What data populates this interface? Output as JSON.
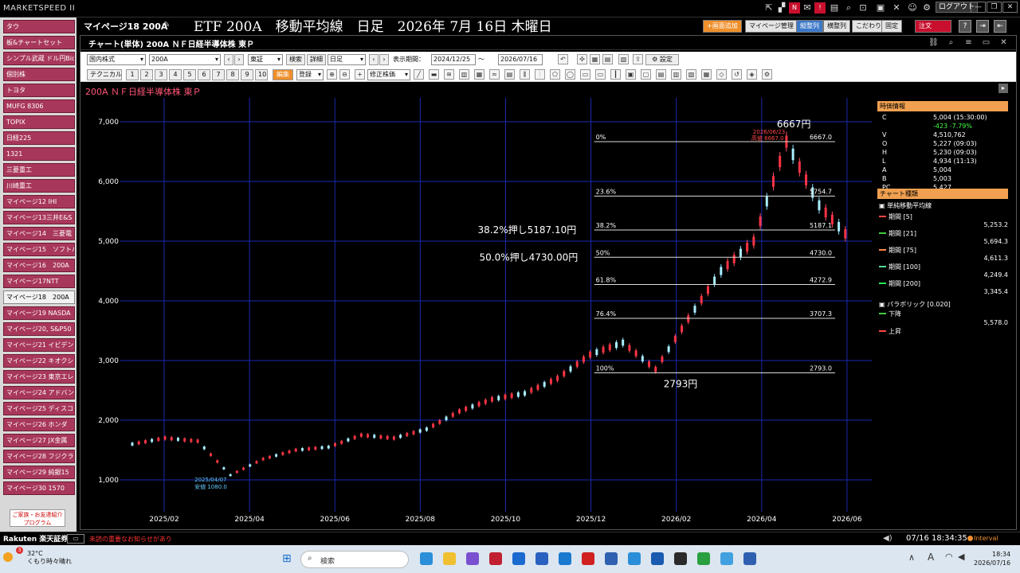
{
  "topbar": {
    "app_name": "MARKETSPEED II",
    "logout": "ログアウト"
  },
  "page": {
    "name": "マイページ18 200A",
    "title": "ETF 200A　移動平均線　日足　2026年 7月 16日 木曜日",
    "add_screen": "+画面追加",
    "mypage_manage": "マイページ管理",
    "vertical": "縦整列",
    "horizontal": "横整列",
    "custom": "こだわり",
    "fixed": "固定",
    "order": "注文",
    "help": "?"
  },
  "sidebar": {
    "items": [
      "タウ",
      "板&チャートセット",
      "シンプル武蔵 ドル円Bid",
      "個別株",
      "トヨタ",
      "MUFG 8306",
      "TOPIX",
      "日経225",
      "1321",
      "三菱重工",
      "川崎重工",
      "マイページ12 IHI",
      "マイページ13三井E&S",
      "マイページ14　三菱電",
      "マイページ15　ソフトバ",
      "マイページ16　200A",
      "マイページ17NTT",
      "マイページ18　200A",
      "マイページ19 NASDA",
      "マイページ20, S&P50",
      "マイページ21 イビデン",
      "マイページ22 キオクシ",
      "マイページ23 東京エレ",
      "マイページ24 アドバン",
      "マイページ25 ディスコ",
      "マイページ26 ホンダ",
      "マイページ27 JX金属",
      "マイページ28 フジクラ",
      "マイページ29 純銀15",
      "マイページ30 1570"
    ],
    "active_index": 17,
    "promo": "ご家族・お友達紹介プログラム"
  },
  "window": {
    "title": "チャート(単体) 200A ＮＦ日経半導体株 東Ｐ"
  },
  "toolbar1": {
    "market": "国内株式",
    "code": "200A",
    "exchange": "東証",
    "search": "検索",
    "detail": "詳細",
    "period": "日足",
    "display_period_label": "表示期間：",
    "date_from": "2024/12/25",
    "tilde": "～",
    "date_to": "2026/07/16",
    "settings": "設定"
  },
  "toolbar2": {
    "technical": "テクニカル",
    "nums": [
      "1",
      "2",
      "3",
      "4",
      "5",
      "6",
      "7",
      "8",
      "9",
      "10"
    ],
    "edit": "編集",
    "register": "登録",
    "adjust": "修正株価"
  },
  "chart_data": {
    "type": "line",
    "title": "200A ＮＦ日経半導体株 東Ｐ",
    "x_labels": [
      "2025/02",
      "2025/04",
      "2025/06",
      "2025/08",
      "2025/10",
      "2025/12",
      "2026/02",
      "2026/04",
      "2026/06"
    ],
    "y_labels": [
      "1,000",
      "2,000",
      "3,000",
      "4,000",
      "5,000",
      "6,000",
      "7,000"
    ],
    "ylim": [
      600,
      7400
    ],
    "dates": [
      "2025-01",
      "2025-02",
      "2025-03",
      "2025-04a",
      "2025-04b",
      "2025-05",
      "2025-06",
      "2025-07",
      "2025-08",
      "2025-09",
      "2025-10",
      "2025-11",
      "2025-12",
      "2026-01",
      "2026-02",
      "2026-03a",
      "2026-03b",
      "2026-04",
      "2026-05a",
      "2026-05b",
      "2026-06",
      "2026-06b",
      "2026-07"
    ],
    "series": [
      {
        "name": "価格",
        "values": [
          1600,
          1700,
          1650,
          1080,
          1350,
          1500,
          1550,
          1750,
          1700,
          1850,
          2150,
          2350,
          2450,
          2700,
          3100,
          3300,
          2850,
          3700,
          4500,
          5000,
          6667,
          5600,
          5004
        ]
      }
    ],
    "fib_levels": [
      {
        "pct": "0%",
        "value": "6667.0"
      },
      {
        "pct": "23.6%",
        "value": "5754.7"
      },
      {
        "pct": "38.2%",
        "value": "5187.1"
      },
      {
        "pct": "50%",
        "value": "4730.0"
      },
      {
        "pct": "61.8%",
        "value": "4272.9"
      },
      {
        "pct": "76.4%",
        "value": "3707.3"
      },
      {
        "pct": "100%",
        "value": "2793.0"
      }
    ],
    "annotations": {
      "high": "6667円",
      "low": "2793円",
      "pull382": "38.2%押し5187.10円",
      "pull50": "50.0%押し4730.00円",
      "low_marker": "2025/04/07",
      "low_marker2": "安値 1080.0",
      "high_marker": "2026/06/23",
      "high_marker2": "高値 6667.0"
    }
  },
  "info": {
    "header": "時価情報",
    "rows": [
      [
        "C",
        "5,004 (15:30:00)"
      ],
      [
        "",
        "-423 -7.79%"
      ],
      [
        "V",
        "4,510,762"
      ],
      [
        "O",
        "5,227 (09:03)"
      ],
      [
        "H",
        "5,230 (09:03)"
      ],
      [
        "L",
        "4,934 (11:13)"
      ],
      [
        "A",
        "5,004"
      ],
      [
        "B",
        "5,003"
      ],
      [
        "PC",
        "5,427"
      ]
    ],
    "chart_type_header": "チャート種類",
    "sma_label": "単純移動平均線",
    "ma": [
      [
        "期間 [5]",
        "5,253.2",
        "#ff4444"
      ],
      [
        "期間 [21]",
        "5,694.3",
        "#44cc44"
      ],
      [
        "期間 [75]",
        "4,611.3",
        "#ff8844"
      ],
      [
        "期間 [100]",
        "4,249.4",
        "#55dd99"
      ],
      [
        "期間 [200]",
        "3,345.4",
        "#22ee55"
      ]
    ],
    "parabolic": "パラボリック [0.020]",
    "par_down": "下降",
    "par_down_val": "5,578.0",
    "par_up": "上昇"
  },
  "status": {
    "broker": "Rakuten 楽天証券",
    "notice": "未読の重要なお知らせがあり",
    "time": "07/16 18:34:35",
    "interval": "Interval"
  },
  "taskbar": {
    "temp": "32°C",
    "weather": "くもり時々晴れ",
    "search": "検索",
    "time": "18:34",
    "date": "2026/07/16"
  }
}
